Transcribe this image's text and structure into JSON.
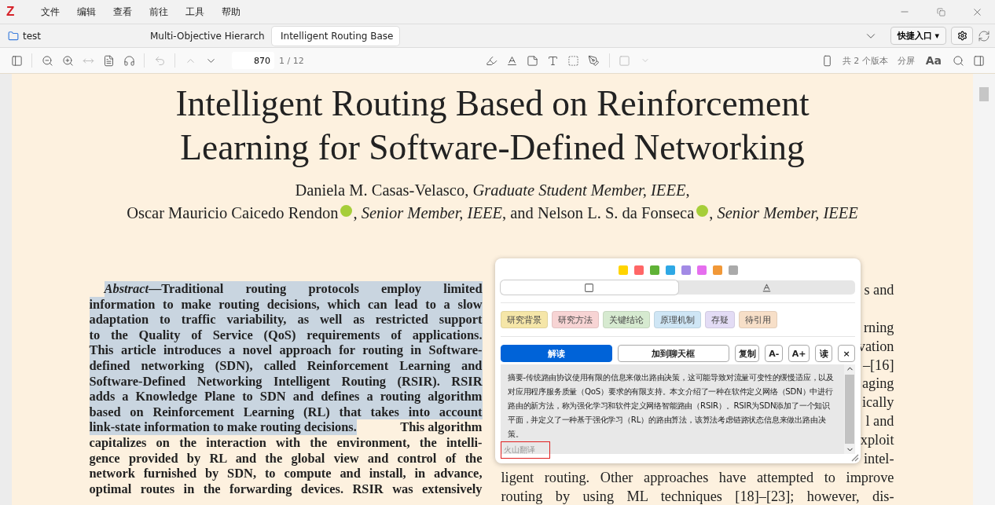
{
  "app": {
    "logo": "Z",
    "menu": [
      "文件",
      "编辑",
      "查看",
      "前往",
      "工具",
      "帮助"
    ]
  },
  "tabs": [
    {
      "label": "test",
      "kind": "library",
      "selected": false
    },
    {
      "label": "Multi-Objective Hierarch",
      "kind": "pdf",
      "selected": false
    },
    {
      "label": "Intelligent Routing Base",
      "kind": "pdf",
      "selected": true
    }
  ],
  "quick_entry": "快捷入口 ▾",
  "toolbar": {
    "page": "870",
    "page_count": "1 / 12",
    "versions": "共 2 个版本",
    "split": "分屏",
    "font": "Aa"
  },
  "paper": {
    "title": "Intelligent Routing Based on Reinforcement Learning for Software-Defined Networking",
    "authors": [
      {
        "parts": [
          {
            "text": "Daniela M. Casas-Velasco, ",
            "orcid": false
          },
          {
            "text": "*Graduate Student Member, IEEE*,",
            "orcid": false
          }
        ]
      },
      {
        "parts": [
          {
            "text": "Oscar Mauricio Caicedo Rendon",
            "orcid": true
          },
          {
            "text": ", *Senior Member, IEEE*, and Nelson L. S. da Fonseca",
            "orcid": true
          },
          {
            "text": ", *Senior Member, IEEE*",
            "orcid": false
          }
        ]
      }
    ],
    "abstract": [
      {
        "segments": [
          {
            "text": "*Abstract*—Traditional routing protocols employ limited",
            "highlighted": true
          }
        ]
      },
      {
        "segments": [
          {
            "text": "information to make routing decisions, which can lead to a slow",
            "highlighted": true
          }
        ]
      },
      {
        "segments": [
          {
            "text": "adaptation to traffic variability, as well as restricted support",
            "highlighted": true
          }
        ]
      },
      {
        "segments": [
          {
            "text": "to the Quality of Service (QoS) requirements of applications.",
            "highlighted": true
          }
        ]
      },
      {
        "segments": [
          {
            "text": "This article introduces a novel approach for routing in Software-",
            "highlighted": true
          }
        ]
      },
      {
        "segments": [
          {
            "text": "defined networking (SDN), called Reinforcement Learning and",
            "highlighted": true
          }
        ]
      },
      {
        "segments": [
          {
            "text": "Software-Defined Networking Intelligent Routing (RSIR). RSIR",
            "highlighted": true
          }
        ]
      },
      {
        "segments": [
          {
            "text": "adds a Knowledge Plane to SDN and defines a routing algorithm",
            "highlighted": true
          }
        ]
      },
      {
        "segments": [
          {
            "text": "based on Reinforcement Learning (RL) that takes into account",
            "highlighted": true
          }
        ]
      },
      {
        "segments": [
          {
            "text": "link-state information to make routing decisions.",
            "highlighted": true
          },
          {
            "text": " This algorithm",
            "highlighted": false
          }
        ]
      },
      {
        "segments": [
          {
            "text": "capitalizes on the interaction with the environment, the intelli-",
            "highlighted": false
          }
        ]
      },
      {
        "segments": [
          {
            "text": "gence provided by RL and the global view and control of the",
            "highlighted": false
          }
        ]
      },
      {
        "segments": [
          {
            "text": "network furnished by SDN, to compute and install, in advance,",
            "highlighted": false
          }
        ]
      },
      {
        "segments": [
          {
            "text": "optimal routes in the forwarding devices. RSIR was extensively",
            "highlighted": false
          }
        ]
      }
    ],
    "right_column": [
      {
        "text": "s and",
        "full": false
      },
      {
        "text": "rning",
        "full": false
      },
      {
        "text": "vation",
        "full": false
      },
      {
        "text": "–[16]",
        "full": false
      },
      {
        "text": "aging",
        "full": false
      },
      {
        "text": "ically",
        "full": false
      },
      {
        "text": "l and",
        "full": false
      },
      {
        "text": "xploit",
        "full": false
      },
      {
        "text": "intel-",
        "full": false
      },
      {
        "text": "ligent routing. Other approaches have attempted to improve",
        "full": true
      },
      {
        "text": "routing by using ML techniques [18]–[23]; however, dis-",
        "full": true
      }
    ]
  },
  "popup": {
    "colors": [
      {
        "color": "#ffd400"
      },
      {
        "color": "#ff6666"
      },
      {
        "color": "#5fb236"
      },
      {
        "color": "#2ea8e5"
      },
      {
        "color": "#a28ae5"
      },
      {
        "color": "#e56eee"
      },
      {
        "color": "#f19837"
      },
      {
        "color": "#aaaaaa"
      }
    ],
    "modes": [
      {
        "kind": "highlight",
        "selected": true
      },
      {
        "kind": "underline",
        "selected": false
      }
    ],
    "tags": [
      {
        "label": "研究背景",
        "color": "#f5e6a8"
      },
      {
        "label": "研究方法",
        "color": "#f7d4d4"
      },
      {
        "label": "关键结论",
        "color": "#d6ead0"
      },
      {
        "label": "原理机制",
        "color": "#cfe6f5"
      },
      {
        "label": "存疑",
        "color": "#e3dcf5"
      },
      {
        "label": "待引用",
        "color": "#f7dfc8"
      }
    ],
    "actions": [
      {
        "label": "解读",
        "kind": "primary"
      },
      {
        "label": "加到聊天框",
        "kind": "wide"
      },
      {
        "label": "复制",
        "kind": "small"
      },
      {
        "label": "A-",
        "kind": "small"
      },
      {
        "label": "A+",
        "kind": "small"
      },
      {
        "label": "读",
        "kind": "small"
      },
      {
        "label": "×",
        "kind": "small"
      }
    ],
    "translation": "摘要-传统路由协议使用有限的信息来做出路由决策，这可能导致对流量可变性的缓慢适应，以及对应用程序服务质量（QoS）要求的有限支持。本文介绍了一种在软件定义网络（SDN）中进行路由的新方法，称为强化学习和软件定义网络智能路由（RSIR）。RSIR为SDN添加了一个知识平面，并定义了一种基于强化学习（RL）的路由算法，该算法考虑链路状态信息来做出路由决策。",
    "engine": "火山翻译"
  }
}
